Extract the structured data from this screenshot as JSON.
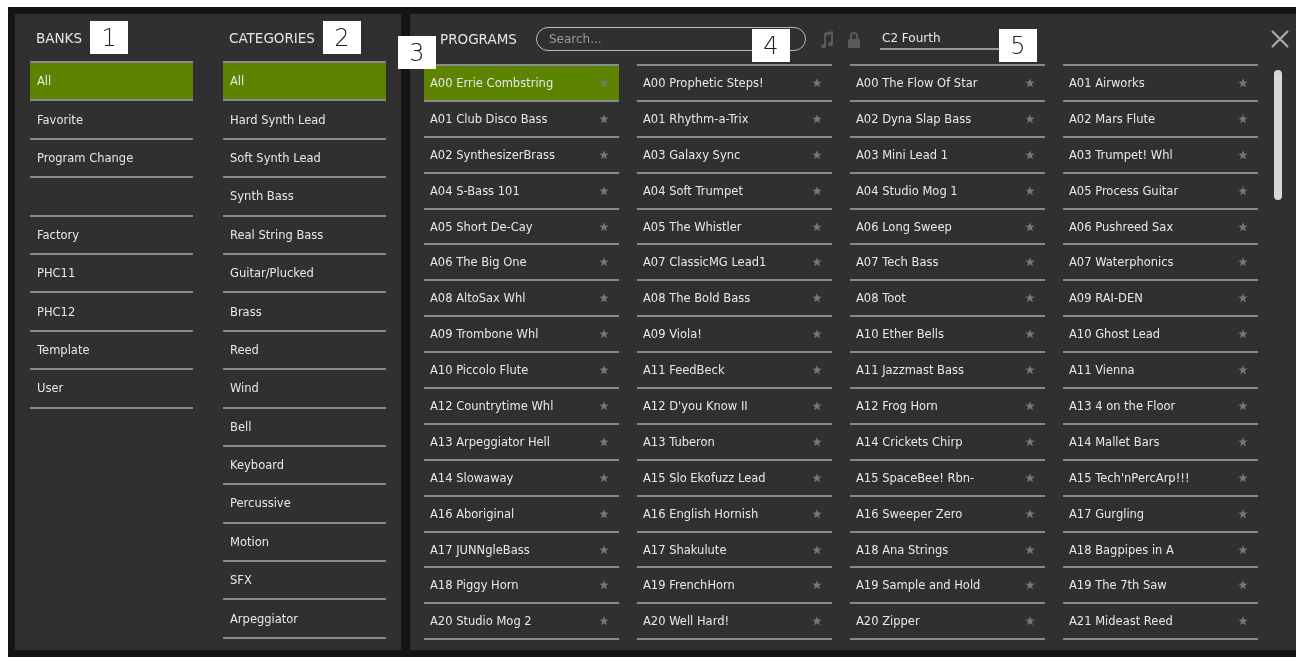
{
  "banks": {
    "title": "BANKS",
    "callout": "1",
    "items": [
      {
        "label": "All",
        "selected": true
      },
      {
        "label": "Favorite",
        "selected": false
      },
      {
        "label": "Program Change",
        "selected": false
      },
      {
        "selected": false
      },
      {
        "label": "Factory",
        "selected": false
      },
      {
        "label": "PHC11",
        "selected": false
      },
      {
        "label": "PHC12",
        "selected": false
      },
      {
        "label": "Template",
        "selected": false
      },
      {
        "label": "User",
        "selected": false
      }
    ]
  },
  "categories": {
    "title": "CATEGORIES",
    "callout": "2",
    "items": [
      {
        "label": "All",
        "selected": true
      },
      {
        "label": "Hard Synth Lead",
        "selected": false
      },
      {
        "label": "Soft Synth Lead",
        "selected": false
      },
      {
        "label": "Synth Bass",
        "selected": false
      },
      {
        "label": "Real String Bass",
        "selected": false
      },
      {
        "label": "Guitar/Plucked",
        "selected": false
      },
      {
        "label": "Brass",
        "selected": false
      },
      {
        "label": "Reed",
        "selected": false
      },
      {
        "label": "Wind",
        "selected": false
      },
      {
        "label": "Bell",
        "selected": false
      },
      {
        "label": "Keyboard",
        "selected": false
      },
      {
        "label": "Percussive",
        "selected": false
      },
      {
        "label": "Motion",
        "selected": false
      },
      {
        "label": "SFX",
        "selected": false
      },
      {
        "label": "Arpeggiator",
        "selected": false
      }
    ]
  },
  "programs": {
    "title": "PROGRAMS",
    "callout": "3",
    "search": {
      "placeholder": "Search...",
      "callout": "4"
    },
    "current": {
      "value": "C2 Fourth",
      "callout": "5"
    },
    "columns": [
      [
        {
          "label": "A00 Errie Combstring",
          "selected": true
        },
        {
          "label": "A01 Club Disco Bass",
          "selected": false
        },
        {
          "label": "A02 SynthesizerBrass",
          "selected": false
        },
        {
          "label": "A04 S-Bass 101",
          "selected": false
        },
        {
          "label": "A05 Short De-Cay",
          "selected": false
        },
        {
          "label": "A06 The Big One",
          "selected": false
        },
        {
          "label": "A08 AltoSax Whl",
          "selected": false
        },
        {
          "label": "A09 Trombone Whl",
          "selected": false
        },
        {
          "label": "A10 Piccolo Flute",
          "selected": false
        },
        {
          "label": "A12 Countrytime Whl",
          "selected": false
        },
        {
          "label": "A13 Arpeggiator Hell",
          "selected": false
        },
        {
          "label": "A14 Slowaway",
          "selected": false
        },
        {
          "label": "A16 Aboriginal",
          "selected": false
        },
        {
          "label": "A17 JUNNgleBass",
          "selected": false
        },
        {
          "label": "A18 Piggy Horn",
          "selected": false
        },
        {
          "label": "A20 Studio Mog 2",
          "selected": false
        }
      ],
      [
        {
          "label": "A00 Prophetic Steps!",
          "selected": false
        },
        {
          "label": "A01 Rhythm-a-Trix",
          "selected": false
        },
        {
          "label": "A03 Galaxy Sync",
          "selected": false
        },
        {
          "label": "A04 Soft Trumpet",
          "selected": false
        },
        {
          "label": "A05 The Whistler",
          "selected": false
        },
        {
          "label": "A07 ClassicMG Lead1",
          "selected": false
        },
        {
          "label": "A08 The Bold Bass",
          "selected": false
        },
        {
          "label": "A09 Viola!",
          "selected": false
        },
        {
          "label": "A11 FeedBeck",
          "selected": false
        },
        {
          "label": "A12 D'you Know II",
          "selected": false
        },
        {
          "label": "A13 Tuberon",
          "selected": false
        },
        {
          "label": "A15 Slo Ekofuzz Lead",
          "selected": false
        },
        {
          "label": "A16 English Hornish",
          "selected": false
        },
        {
          "label": "A17 Shakulute",
          "selected": false
        },
        {
          "label": "A19 FrenchHorn",
          "selected": false
        },
        {
          "label": "A20 Well Hard!",
          "selected": false
        }
      ],
      [
        {
          "label": "A00 The Flow Of Star",
          "selected": false
        },
        {
          "label": "A02 Dyna Slap Bass",
          "selected": false
        },
        {
          "label": "A03 Mini Lead 1",
          "selected": false
        },
        {
          "label": "A04 Studio Mog 1",
          "selected": false
        },
        {
          "label": "A06 Long Sweep",
          "selected": false
        },
        {
          "label": "A07 Tech Bass",
          "selected": false
        },
        {
          "label": "A08 Toot",
          "selected": false
        },
        {
          "label": "A10 Ether Bells",
          "selected": false
        },
        {
          "label": "A11 Jazzmast Bass",
          "selected": false
        },
        {
          "label": "A12 Frog Horn",
          "selected": false
        },
        {
          "label": "A14 Crickets Chirp",
          "selected": false
        },
        {
          "label": "A15 SpaceBee! Rbn-",
          "selected": false
        },
        {
          "label": "A16 Sweeper Zero",
          "selected": false
        },
        {
          "label": "A18 Ana Strings",
          "selected": false
        },
        {
          "label": "A19 Sample and Hold",
          "selected": false
        },
        {
          "label": "A20 Zipper",
          "selected": false
        }
      ],
      [
        {
          "label": "A01 Airworks",
          "selected": false
        },
        {
          "label": "A02 Mars Flute",
          "selected": false
        },
        {
          "label": "A03 Trumpet! Whl",
          "selected": false
        },
        {
          "label": "A05 Process Guitar",
          "selected": false
        },
        {
          "label": "A06 Pushreed Sax",
          "selected": false
        },
        {
          "label": "A07 Waterphonics",
          "selected": false
        },
        {
          "label": "A09 RAI-DEN",
          "selected": false
        },
        {
          "label": "A10 Ghost Lead",
          "selected": false
        },
        {
          "label": "A11 Vienna",
          "selected": false
        },
        {
          "label": "A13 4 on the Floor",
          "selected": false
        },
        {
          "label": "A14 Mallet Bars",
          "selected": false
        },
        {
          "label": "A15 Tech'nPercArp!!!",
          "selected": false
        },
        {
          "label": "A17 Gurgling",
          "selected": false
        },
        {
          "label": "A18 Bagpipes in A",
          "selected": false
        },
        {
          "label": "A19 The 7th Saw",
          "selected": false
        },
        {
          "label": "A21 Mideast Reed",
          "selected": false
        }
      ]
    ]
  }
}
